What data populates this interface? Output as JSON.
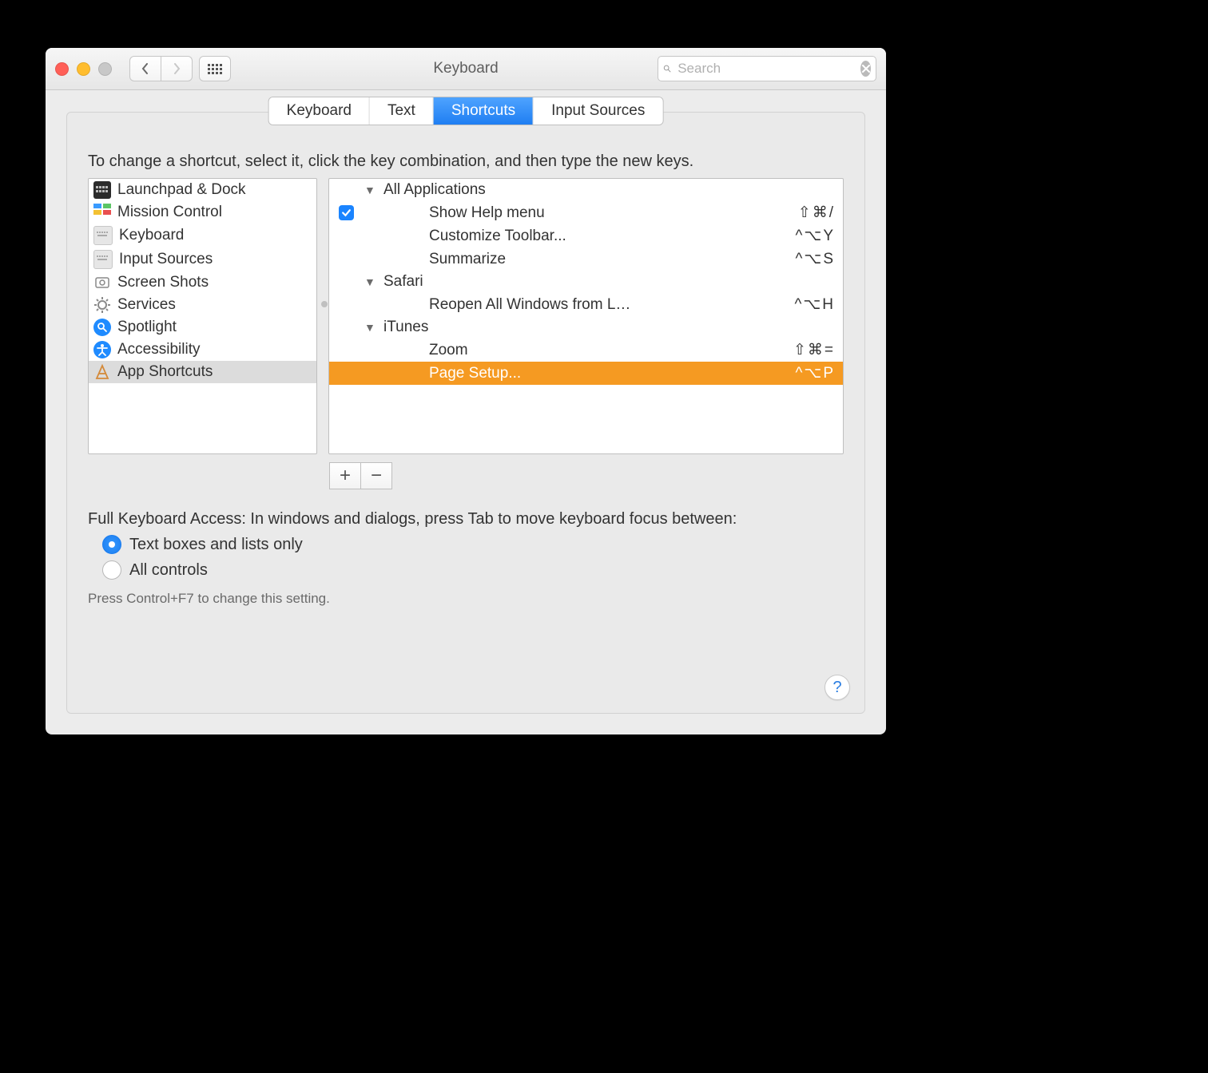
{
  "window": {
    "title": "Keyboard"
  },
  "search": {
    "placeholder": "Search"
  },
  "tabs": [
    "Keyboard",
    "Text",
    "Shortcuts",
    "Input Sources"
  ],
  "active_tab": 2,
  "instruction": "To change a shortcut, select it, click the key combination, and then type the new keys.",
  "categories": [
    {
      "label": "Launchpad & Dock",
      "icon": "launchpad"
    },
    {
      "label": "Mission Control",
      "icon": "mission"
    },
    {
      "label": "Keyboard",
      "icon": "keyboard"
    },
    {
      "label": "Input Sources",
      "icon": "keyboard"
    },
    {
      "label": "Screen Shots",
      "icon": "screenshot"
    },
    {
      "label": "Services",
      "icon": "gear"
    },
    {
      "label": "Spotlight",
      "icon": "search"
    },
    {
      "label": "Accessibility",
      "icon": "accessibility"
    },
    {
      "label": "App Shortcuts",
      "icon": "app",
      "selected": true
    }
  ],
  "shortcuts": [
    {
      "type": "group",
      "label": "All Applications"
    },
    {
      "type": "item",
      "label": "Show Help menu",
      "keys": "⇧⌘/",
      "checked": true
    },
    {
      "type": "item",
      "label": "Customize Toolbar...",
      "keys": "^⌥Y"
    },
    {
      "type": "item",
      "label": "Summarize",
      "keys": "^⌥S"
    },
    {
      "type": "group",
      "label": "Safari"
    },
    {
      "type": "item",
      "label": "Reopen All Windows from L…",
      "keys": "^⌥H"
    },
    {
      "type": "group",
      "label": "iTunes"
    },
    {
      "type": "item",
      "label": "Zoom",
      "keys": "⇧⌘="
    },
    {
      "type": "item",
      "label": "Page Setup...",
      "keys": "^⌥P",
      "selected": true
    }
  ],
  "footer": {
    "heading": "Full Keyboard Access: In windows and dialogs, press Tab to move keyboard focus between:",
    "options": [
      "Text boxes and lists only",
      "All controls"
    ],
    "selected_option": 0,
    "hint": "Press Control+F7 to change this setting."
  },
  "buttons": {
    "add": "+",
    "remove": "−",
    "help": "?"
  }
}
